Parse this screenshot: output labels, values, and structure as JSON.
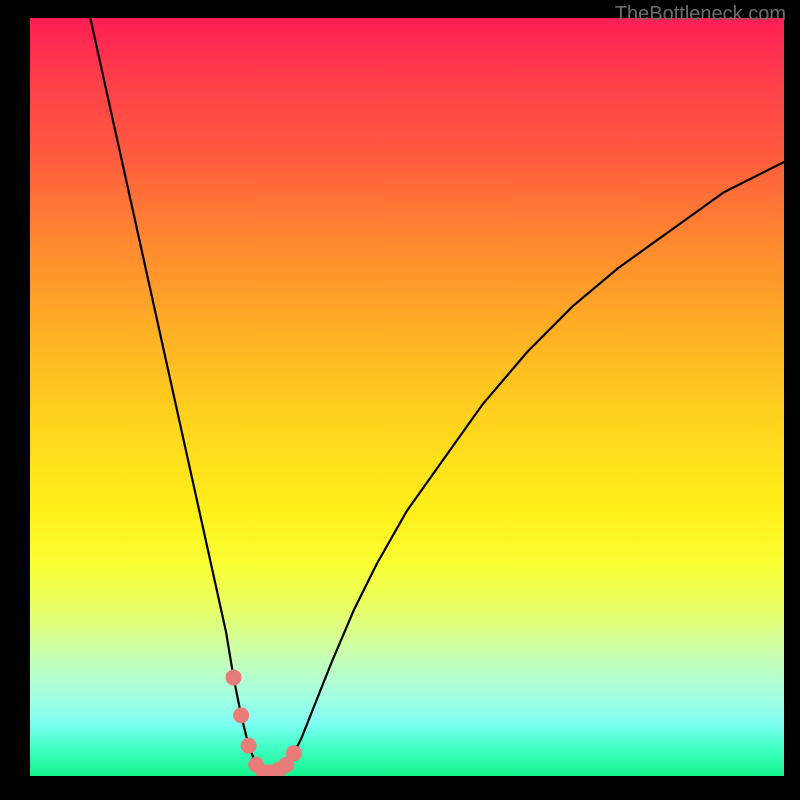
{
  "watermark": "TheBottleneck.com",
  "chart_data": {
    "type": "line",
    "title": "",
    "xlabel": "",
    "ylabel": "",
    "xlim": [
      0,
      100
    ],
    "ylim": [
      0,
      100
    ],
    "x": [
      8,
      10,
      12,
      14,
      16,
      18,
      20,
      22,
      24,
      26,
      27,
      28,
      29,
      30,
      31,
      32,
      33,
      34,
      35,
      36,
      38,
      40,
      43,
      46,
      50,
      55,
      60,
      66,
      72,
      78,
      85,
      92,
      100
    ],
    "values": [
      100,
      91,
      82,
      73,
      64,
      55,
      46,
      37,
      28,
      19,
      13,
      8,
      4,
      1.5,
      0.5,
      0.5,
      0.8,
      1.5,
      3,
      5,
      10,
      15,
      22,
      28,
      35,
      42,
      49,
      56,
      62,
      67,
      72,
      77,
      81
    ],
    "markers": {
      "x": [
        27.0,
        28.0,
        29.0,
        30.0,
        31.0,
        32.0,
        33.0,
        34.0,
        35.0
      ],
      "y": [
        13.0,
        8.0,
        4.0,
        1.5,
        0.5,
        0.5,
        0.8,
        1.5,
        3.0
      ],
      "color": "#e97c78",
      "size": 8
    },
    "background_gradient": {
      "top_color": "#ff1e55",
      "bottom_color": "#14f58a",
      "orientation": "vertical"
    },
    "line_color": "#000000"
  }
}
